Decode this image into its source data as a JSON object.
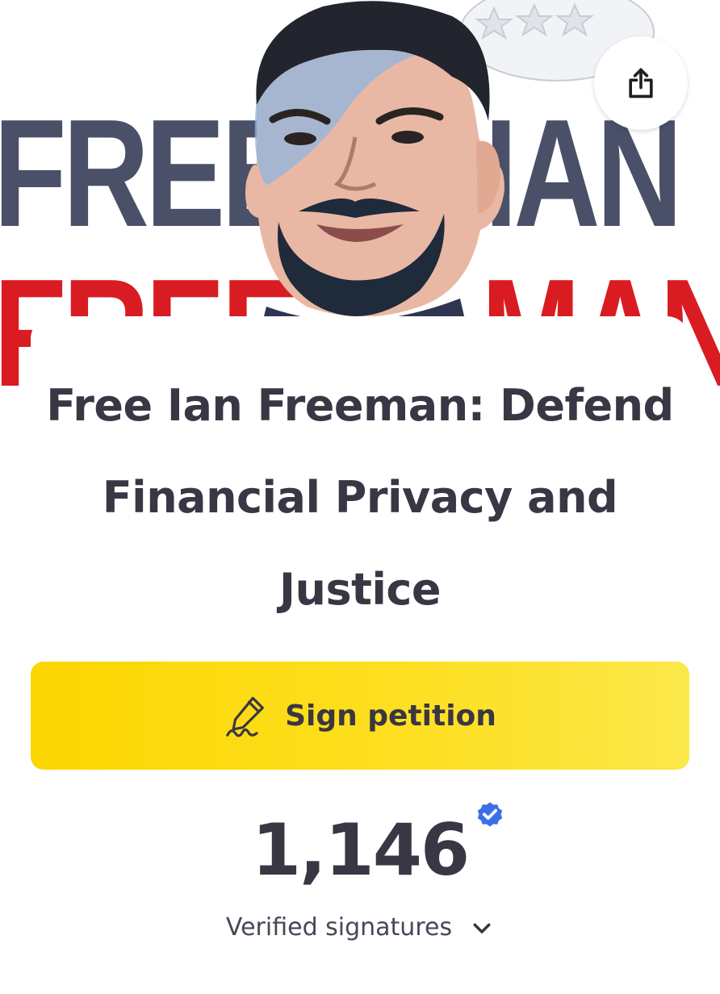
{
  "hero": {
    "banner_words": {
      "top_left": "FREE",
      "top_right": "IAN",
      "bottom_left": "FREE",
      "bottom_right": "MAN"
    },
    "icons": {
      "share": "share-icon"
    }
  },
  "petition": {
    "title": "Free Ian Freeman: Defend Financial Privacy and Justice",
    "sign_button_label": "Sign petition",
    "sign_icon": "signature-pen-icon",
    "signature_count": "1,146",
    "verified_badge_icon": "verified-badge-icon",
    "verified_label": "Verified signatures",
    "expand_icon": "chevron-down-icon"
  },
  "colors": {
    "button_yellow": "#fcd600",
    "title_text": "#3a3644",
    "verified_blue": "#3b6fe8",
    "banner_red": "#d91c22",
    "banner_slate": "#4a5068"
  }
}
